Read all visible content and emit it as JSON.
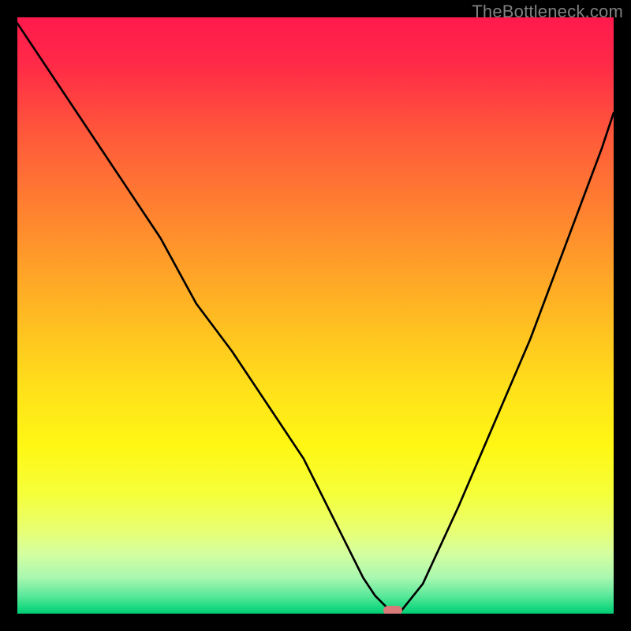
{
  "watermark": {
    "text": "TheBottleneck.com"
  },
  "chart_data": {
    "type": "line",
    "title": "",
    "xlabel": "",
    "ylabel": "",
    "xlim": [
      0,
      100
    ],
    "ylim": [
      0,
      100
    ],
    "series": [
      {
        "name": "bottleneck-curve",
        "x": [
          0,
          6,
          12,
          18,
          24,
          30,
          36,
          42,
          48,
          54,
          58,
          60,
          62,
          63,
          64,
          68,
          74,
          80,
          86,
          92,
          98,
          100
        ],
        "values": [
          99,
          90,
          81,
          72,
          63,
          52,
          44,
          35,
          26,
          14,
          6,
          3,
          1,
          0,
          0,
          5,
          18,
          32,
          46,
          62,
          78,
          84
        ]
      }
    ],
    "marker": {
      "x": 63,
      "y": 0,
      "color": "#d97a7a"
    },
    "background_gradient_stops": [
      {
        "pos": 0.0,
        "color": "#ff1a4d"
      },
      {
        "pos": 0.08,
        "color": "#ff2a47"
      },
      {
        "pos": 0.2,
        "color": "#ff5a3a"
      },
      {
        "pos": 0.35,
        "color": "#ff8a2e"
      },
      {
        "pos": 0.5,
        "color": "#ffba22"
      },
      {
        "pos": 0.62,
        "color": "#ffe01a"
      },
      {
        "pos": 0.72,
        "color": "#fff714"
      },
      {
        "pos": 0.8,
        "color": "#f5ff3a"
      },
      {
        "pos": 0.86,
        "color": "#e8ff72"
      },
      {
        "pos": 0.9,
        "color": "#d4ffa0"
      },
      {
        "pos": 0.94,
        "color": "#a8f7b0"
      },
      {
        "pos": 0.97,
        "color": "#5ae89a"
      },
      {
        "pos": 0.99,
        "color": "#1ad980"
      },
      {
        "pos": 1.0,
        "color": "#00cc74"
      }
    ]
  }
}
